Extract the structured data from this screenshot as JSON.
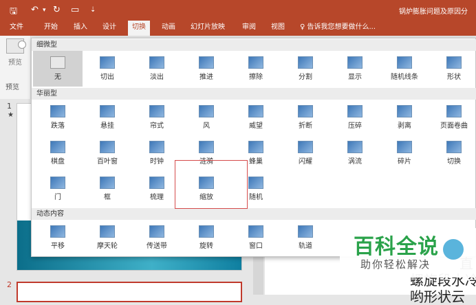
{
  "app": {
    "title": "锅炉膨胀问题及原因分",
    "colors": {
      "accent": "#b7472a",
      "highlight": "#d54a4a",
      "watermark": "#2aa24a"
    }
  },
  "quick_access": [
    {
      "name": "save-icon",
      "glyph": "🖫"
    },
    {
      "name": "undo-icon",
      "glyph": "↶"
    },
    {
      "name": "dropdown-icon",
      "glyph": "▾"
    },
    {
      "name": "redo-icon",
      "glyph": "↻"
    },
    {
      "name": "present-icon",
      "glyph": "▭"
    },
    {
      "name": "customize-icon",
      "glyph": "⇣"
    }
  ],
  "tabs": [
    "文件",
    "开始",
    "插入",
    "设计",
    "切换",
    "动画",
    "幻灯片放映",
    "审阅",
    "视图"
  ],
  "active_tab": "切换",
  "tell_me": "♀ 告诉我您想要做什么...",
  "ribbon": {
    "preview_label": "预览",
    "preview_group": "预览"
  },
  "gallery": {
    "sections": [
      {
        "title": "细微型",
        "items": [
          "无",
          "切出",
          "淡出",
          "推进",
          "擦除",
          "分割",
          "显示",
          "随机线条",
          "形状"
        ]
      },
      {
        "title": "华丽型",
        "items": [
          "跌落",
          "悬挂",
          "帘式",
          "风",
          "威望",
          "折断",
          "压碎",
          "剥离",
          "页面卷曲",
          "棋盘",
          "百叶窗",
          "时钟",
          "涟漪",
          "蜂巢",
          "闪耀",
          "涡流",
          "碎片",
          "切换",
          "门",
          "框",
          "梳理",
          "缩放",
          "随机"
        ]
      },
      {
        "title": "动态内容",
        "items": [
          "平移",
          "摩天轮",
          "传送带",
          "旋转",
          "窗口",
          "轨道"
        ]
      }
    ],
    "selected": "无",
    "highlighted": "缩放"
  },
  "slides": {
    "numbers": [
      "1",
      "2"
    ],
    "star": "★"
  },
  "canvas_text": [
    "直",
    "螺旋段水冷",
    "哟形状云"
  ],
  "watermark": {
    "title": "百科全说",
    "subtitle": "助你轻松解决"
  }
}
